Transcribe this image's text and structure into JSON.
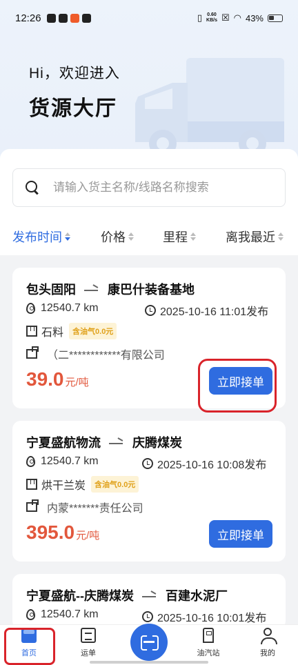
{
  "status_bar": {
    "time": "12:26",
    "net_speed_value": "0.60",
    "net_speed_unit": "KB/s",
    "battery": "43%"
  },
  "hero": {
    "greeting": "Hi，欢迎进入",
    "title": "货源大厅"
  },
  "search": {
    "placeholder": "请输入货主名称/线路名称搜索"
  },
  "sort": {
    "publish_time": "发布时间",
    "price": "价格",
    "mileage": "里程",
    "nearest": "离我最近"
  },
  "cards": [
    {
      "origin": "包头固阳",
      "destination": "康巴什装备基地",
      "distance": "12540.7 km",
      "published": "2025-10-16 11:01发布",
      "goods": "石料",
      "tag": "含油气0.0元",
      "company": "（二************有限公司",
      "price": "39.0",
      "unit": "元/吨",
      "button": "立即接单"
    },
    {
      "origin": "宁夏盛航物流",
      "destination": "庆腾煤炭",
      "distance": "12540.7 km",
      "published": "2025-10-16 10:08发布",
      "goods": "烘干兰炭",
      "tag": "含油气0.0元",
      "company": "内蒙*******责任公司",
      "price": "395.0",
      "unit": "元/吨",
      "button": "立即接单"
    },
    {
      "origin": "宁夏盛航--庆腾煤炭",
      "destination": "百建水泥厂",
      "distance": "12540.7 km",
      "published": "2025-10-16 10:01发布"
    }
  ],
  "tabbar": {
    "home": "首页",
    "orders": "运单",
    "gas": "油汽站",
    "me": "我的"
  },
  "colors": {
    "accent": "#2f6ce0",
    "price": "#e2573c",
    "highlight": "#d9232a",
    "tag_bg": "#fdf3d6",
    "tag_text": "#e0a11b"
  }
}
